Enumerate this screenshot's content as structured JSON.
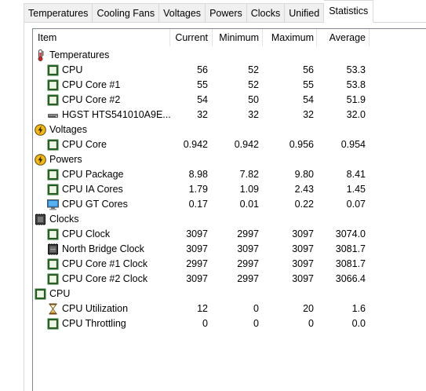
{
  "tabs": [
    {
      "label": "Temperatures",
      "active": false
    },
    {
      "label": "Cooling Fans",
      "active": false
    },
    {
      "label": "Voltages",
      "active": false
    },
    {
      "label": "Powers",
      "active": false
    },
    {
      "label": "Clocks",
      "active": false
    },
    {
      "label": "Unified",
      "active": false
    },
    {
      "label": "Statistics",
      "active": true
    }
  ],
  "columns": {
    "item": "Item",
    "current": "Current",
    "minimum": "Minimum",
    "maximum": "Maximum",
    "average": "Average"
  },
  "rows": [
    {
      "group": true,
      "icon": "thermometer-icon",
      "label": "Temperatures"
    },
    {
      "icon": "chip-icon",
      "label": "CPU",
      "current": "56",
      "minimum": "52",
      "maximum": "56",
      "average": "53.3"
    },
    {
      "icon": "chip-icon",
      "label": "CPU Core #1",
      "current": "55",
      "minimum": "52",
      "maximum": "55",
      "average": "53.8"
    },
    {
      "icon": "chip-icon",
      "label": "CPU Core #2",
      "current": "54",
      "minimum": "50",
      "maximum": "54",
      "average": "51.9"
    },
    {
      "icon": "hard-drive-icon",
      "label": "HGST HTS541010A9E...",
      "current": "32",
      "minimum": "32",
      "maximum": "32",
      "average": "32.0"
    },
    {
      "group": true,
      "icon": "lightning-icon",
      "label": "Voltages"
    },
    {
      "icon": "chip-icon",
      "label": "CPU Core",
      "current": "0.942",
      "minimum": "0.942",
      "maximum": "0.956",
      "average": "0.954"
    },
    {
      "group": true,
      "icon": "lightning-icon",
      "label": "Powers"
    },
    {
      "icon": "chip-icon",
      "label": "CPU Package",
      "current": "8.98",
      "minimum": "7.82",
      "maximum": "9.80",
      "average": "8.41"
    },
    {
      "icon": "chip-icon",
      "label": "CPU IA Cores",
      "current": "1.79",
      "minimum": "1.09",
      "maximum": "2.43",
      "average": "1.45"
    },
    {
      "icon": "monitor-icon",
      "label": "CPU GT Cores",
      "current": "0.17",
      "minimum": "0.01",
      "maximum": "0.22",
      "average": "0.07"
    },
    {
      "group": true,
      "icon": "clock-chip-icon",
      "label": "Clocks"
    },
    {
      "icon": "chip-icon",
      "label": "CPU Clock",
      "current": "3097",
      "minimum": "2997",
      "maximum": "3097",
      "average": "3074.0"
    },
    {
      "icon": "bridge-chip-icon",
      "label": "North Bridge Clock",
      "current": "3097",
      "minimum": "3097",
      "maximum": "3097",
      "average": "3081.7"
    },
    {
      "icon": "chip-icon",
      "label": "CPU Core #1 Clock",
      "current": "2997",
      "minimum": "2997",
      "maximum": "3097",
      "average": "3081.7"
    },
    {
      "icon": "chip-icon",
      "label": "CPU Core #2 Clock",
      "current": "3097",
      "minimum": "2997",
      "maximum": "3097",
      "average": "3066.4"
    },
    {
      "group": true,
      "icon": "chip-icon",
      "label": "CPU"
    },
    {
      "icon": "hourglass-icon",
      "label": "CPU Utilization",
      "current": "12",
      "minimum": "0",
      "maximum": "20",
      "average": "1.6"
    },
    {
      "icon": "chip-icon",
      "label": "CPU Throttling",
      "current": "0",
      "minimum": "0",
      "maximum": "0",
      "average": "0.0"
    }
  ]
}
